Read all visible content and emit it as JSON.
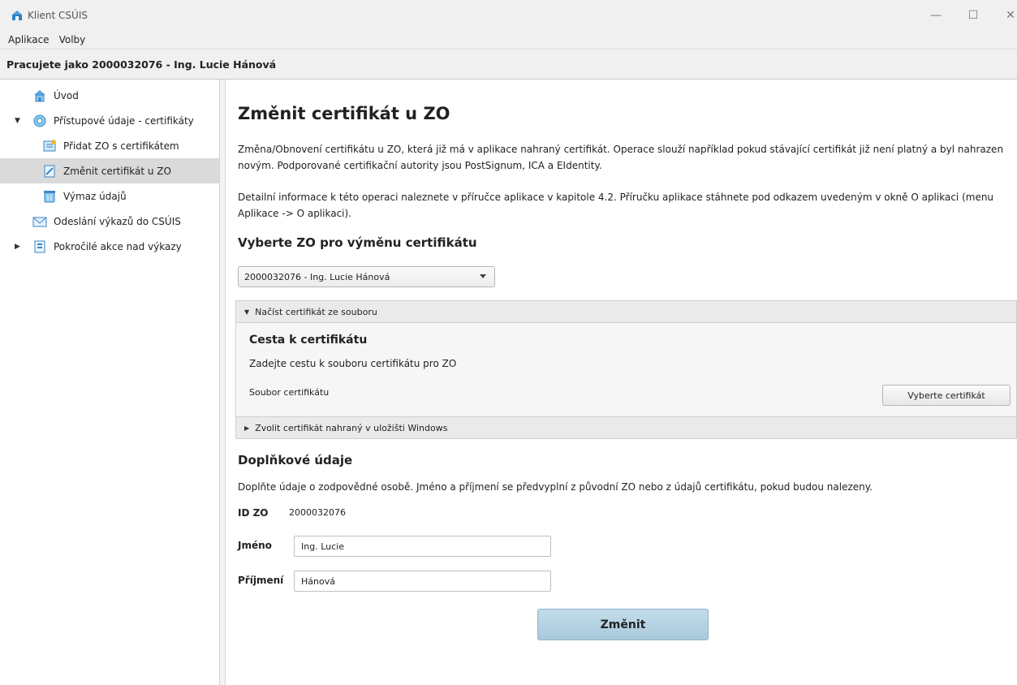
{
  "window": {
    "title": "Klient CSÚIS",
    "minimize_glyph": "—",
    "maximize_glyph": "☐",
    "close_glyph": "✕"
  },
  "menu": [
    "Aplikace",
    "Volby"
  ],
  "user_bar": "Pracujete jako 2000032076 - Ing. Lucie Hánová",
  "sidebar": {
    "items": [
      {
        "label": "Úvod",
        "icon": "home-icon"
      },
      {
        "label": "Přístupové údaje - certifikáty",
        "icon": "certificate-icon",
        "expanded": true
      },
      {
        "label": "Přidat ZO s certifikátem",
        "icon": "add-document-icon"
      },
      {
        "label": "Změnit certifikát u ZO",
        "icon": "edit-document-icon",
        "selected": true
      },
      {
        "label": "Výmaz údajů",
        "icon": "delete-data-icon"
      },
      {
        "label": "Odeslání výkazů do CSÚIS",
        "icon": "envelope-icon"
      },
      {
        "label": "Pokročilé akce nad výkazy",
        "icon": "advanced-reports-icon",
        "expanded": false
      }
    ]
  },
  "main": {
    "title": "Změnit certifikát u ZO",
    "description_1": "Změna/Obnovení certifikátu u ZO, která již má v aplikace nahraný certifikát. Operace slouží například pokud stávající certifikát již není platný a byl nahrazen novým. Podporované certifikační autority jsou PostSignum, ICA a EIdentity.",
    "description_2": "Detailní informace k této operaci naleznete v příručce aplikace v kapitole 4.2. Příručku aplikace stáhnete pod odkazem uvedeným v okně O aplikaci (menu Aplikace -> O aplikaci).",
    "select_heading": "Vyberte ZO pro výměnu certifikátu",
    "zo_select_value": "2000032076 - Ing. Lucie Hánová",
    "pane_file": {
      "header": "Načíst certifikát ze souboru",
      "expanded": true,
      "title": "Cesta k certifikátu",
      "hint": "Zadejte cestu k souboru certifikátu pro ZO",
      "file_label": "Soubor certifikátu",
      "button": "Vyberte certifikát"
    },
    "pane_windows": {
      "header": "Zvolit certifikát nahraný v uložišti Windows",
      "expanded": false
    },
    "extra_heading": "Doplňkové údaje",
    "extra_hint": "Doplňte údaje o zodpovědné osobě. Jméno a příjmení se předvyplní z původní ZO nebo z údajů certifikátu, pokud budou nalezeny.",
    "id_label": "ID ZO",
    "id_value": "2000032076",
    "first_name_label": "Jméno",
    "first_name_value": "Ing. Lucie",
    "last_name_label": "Příjmení",
    "last_name_value": "Hánová",
    "submit_label": "Změnit"
  },
  "colors": {
    "selected_row": "#dadada",
    "submit_button": "#b6d3e3",
    "chrome": "#f0f0f0"
  }
}
